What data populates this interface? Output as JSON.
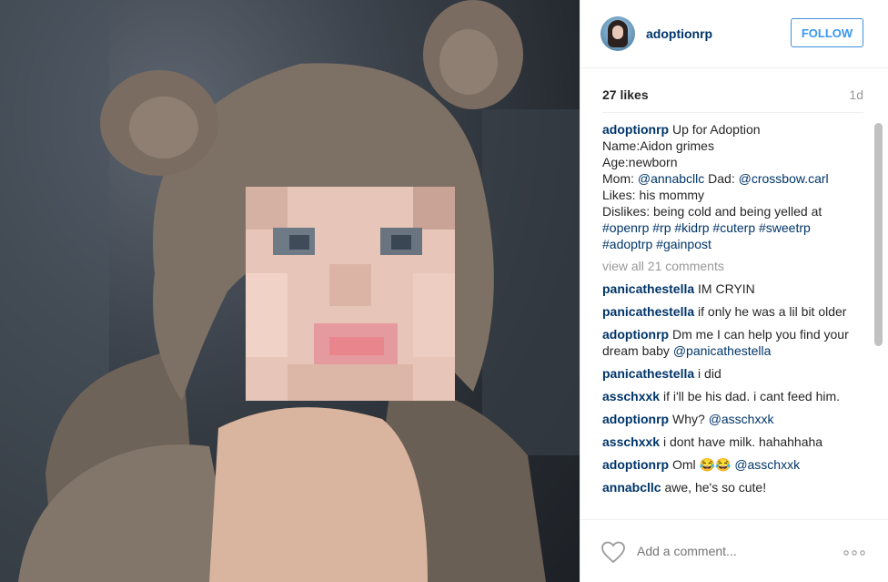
{
  "post": {
    "username": "adoptionrp",
    "follow_label": "FOLLOW",
    "likes": "27 likes",
    "time": "1d",
    "caption_lines": {
      "l1_text": "Up for Adoption",
      "l2": "Name:Aidon grimes",
      "l3": "Age:newborn",
      "l4_prefix": "Mom: ",
      "l4_mom": "@annabcllc",
      "l4_mid": " Dad: ",
      "l4_dad": "@crossbow.carl",
      "l5": "Likes: his mommy",
      "l6": "Dislikes: being cold and being yelled at",
      "l7": "#openrp #rp #kidrp #cuterp #sweetrp",
      "l8": "#adoptrp #gainpost"
    },
    "view_all": "view all 21 comments"
  },
  "comments": [
    {
      "user": "panicathestella",
      "text": "IM CRYIN",
      "mention": ""
    },
    {
      "user": "panicathestella",
      "text": "if only he was a lil bit older",
      "mention": ""
    },
    {
      "user": "adoptionrp",
      "text": "Dm me I can help you find your dream baby",
      "mention": "@panicathestella"
    },
    {
      "user": "panicathestella",
      "text": "i did",
      "mention": ""
    },
    {
      "user": "asschxxk",
      "text": "if i'll be his dad. i cant feed him.",
      "mention": ""
    },
    {
      "user": "adoptionrp",
      "text": "Why?",
      "mention": "@asschxxk"
    },
    {
      "user": "asschxxk",
      "text": "i dont have milk. hahahhaha",
      "mention": ""
    },
    {
      "user": "adoptionrp",
      "text": "Oml 😂😂",
      "mention": "@asschxxk"
    },
    {
      "user": "annabcllc",
      "text": "awe, he's so cute!",
      "mention": ""
    }
  ],
  "composer": {
    "placeholder": "Add a comment...",
    "more_label": "..."
  },
  "icons": {
    "heart": "heart-icon",
    "more": "more-options-icon"
  },
  "colors": {
    "accent": "#3897f0",
    "username": "#003569",
    "muted": "#999999"
  }
}
